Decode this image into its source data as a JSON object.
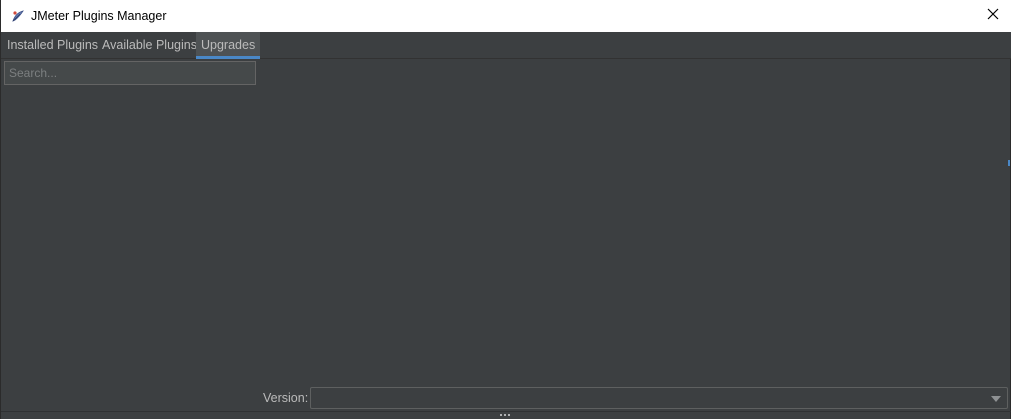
{
  "window": {
    "title": "JMeter Plugins Manager",
    "icon": "feather-icon",
    "close_icon": "close-icon"
  },
  "tabs": [
    {
      "label": "Installed Plugins",
      "selected": false
    },
    {
      "label": "Available Plugins",
      "selected": false
    },
    {
      "label": "Upgrades",
      "selected": true
    }
  ],
  "search": {
    "placeholder": "Search...",
    "value": ""
  },
  "version": {
    "label": "Version:",
    "selected_value": ""
  },
  "colors": {
    "background": "#3c3f41",
    "accent": "#4a88c7",
    "text": "#bbbbbb",
    "titlebar": "#ffffff"
  }
}
